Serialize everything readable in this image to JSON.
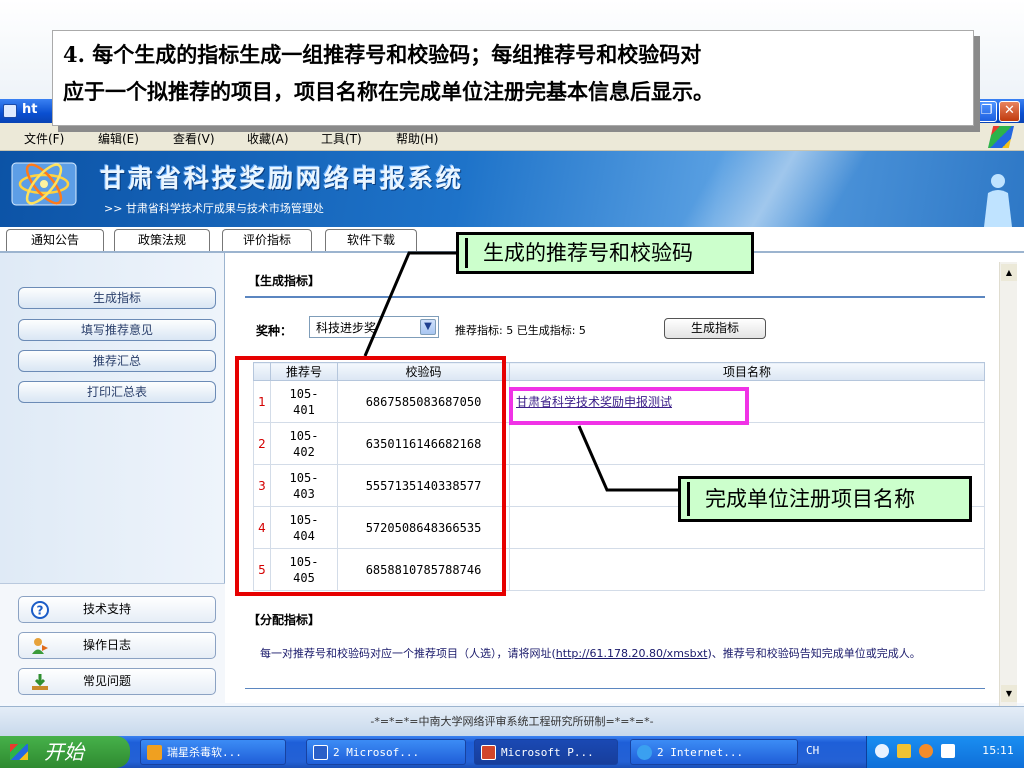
{
  "slide": {
    "line1": "4.  每个生成的指标生成一组推荐号和校验码；每组推荐号和校验码对",
    "line2": "应于一个拟推荐的项目，项目名称在完成单位注册完基本信息后显示。"
  },
  "browser": {
    "title": "ht",
    "menu": [
      "文件(F)",
      "编辑(E)",
      "查看(V)",
      "收藏(A)",
      "工具(T)",
      "帮助(H)"
    ]
  },
  "site": {
    "title": "甘肃省科技奖励网络申报系统",
    "subtitle": ">> 甘肃省科学技术厅成果与技术市场管理处"
  },
  "nav": {
    "tabs": [
      "通知公告",
      "政策法规",
      "评价指标",
      "软件下载"
    ]
  },
  "sidebar": {
    "items": [
      "生成指标",
      "填写推荐意见",
      "推荐汇总",
      "打印汇总表"
    ],
    "bottom": [
      {
        "label": "技术支持",
        "icon": "help-icon"
      },
      {
        "label": "操作日志",
        "icon": "user-log-icon"
      },
      {
        "label": "常见问题",
        "icon": "faq-icon"
      }
    ]
  },
  "content": {
    "section_title": "【生成指标】",
    "award_label": "奖种：",
    "award_value": "科技进步奖",
    "quota_text": "推荐指标: 5   已生成指标: 5",
    "generate_button": "生成指标",
    "table": {
      "headers": [
        "",
        "推荐号",
        "校验码",
        "项目名称"
      ],
      "rows": [
        {
          "index": "1",
          "no_a": "105-",
          "no_b": "401",
          "code": "6867585083687050",
          "project": "甘肃省科学技术奖励申报测试"
        },
        {
          "index": "2",
          "no_a": "105-",
          "no_b": "402",
          "code": "6350116146682168",
          "project": ""
        },
        {
          "index": "3",
          "no_a": "105-",
          "no_b": "403",
          "code": "5557135140338577",
          "project": ""
        },
        {
          "index": "4",
          "no_a": "105-",
          "no_b": "404",
          "code": "5720508648366535",
          "project": ""
        },
        {
          "index": "5",
          "no_a": "105-",
          "no_b": "405",
          "code": "6858810785788746",
          "project": ""
        }
      ]
    },
    "alloc_title": "【分配指标】",
    "alloc_text_pre": "每一对推荐号和校验码对应一个推荐项目（人选），请将网址(",
    "alloc_link": "http://61.178.20.80/xmsbxt",
    "alloc_text_post": ")、推荐号和校验码告知完成单位或完成人。"
  },
  "footer": {
    "text": "-*=*=*=中南大学网络评审系统工程研究所研制=*=*=*-"
  },
  "annotations": {
    "callout_codes": "生成的推荐号和校验码",
    "callout_project": "完成单位注册项目名称"
  },
  "taskbar": {
    "start": "开始",
    "tasks": [
      {
        "label": "瑞星杀毒软...",
        "icon": "antivirus-icon"
      },
      {
        "label": "2 Microsof...",
        "icon": "word-icon"
      },
      {
        "label": "Microsoft P...",
        "icon": "powerpoint-icon"
      },
      {
        "label": "2 Internet...",
        "icon": "ie-icon"
      }
    ],
    "ime": "CH",
    "clock": "15:11"
  },
  "colors": {
    "highlight_red": "#e60000",
    "highlight_magenta": "#f032e6",
    "callout_fill": "#ccffcc",
    "banner_blue": "#1e73c9"
  }
}
